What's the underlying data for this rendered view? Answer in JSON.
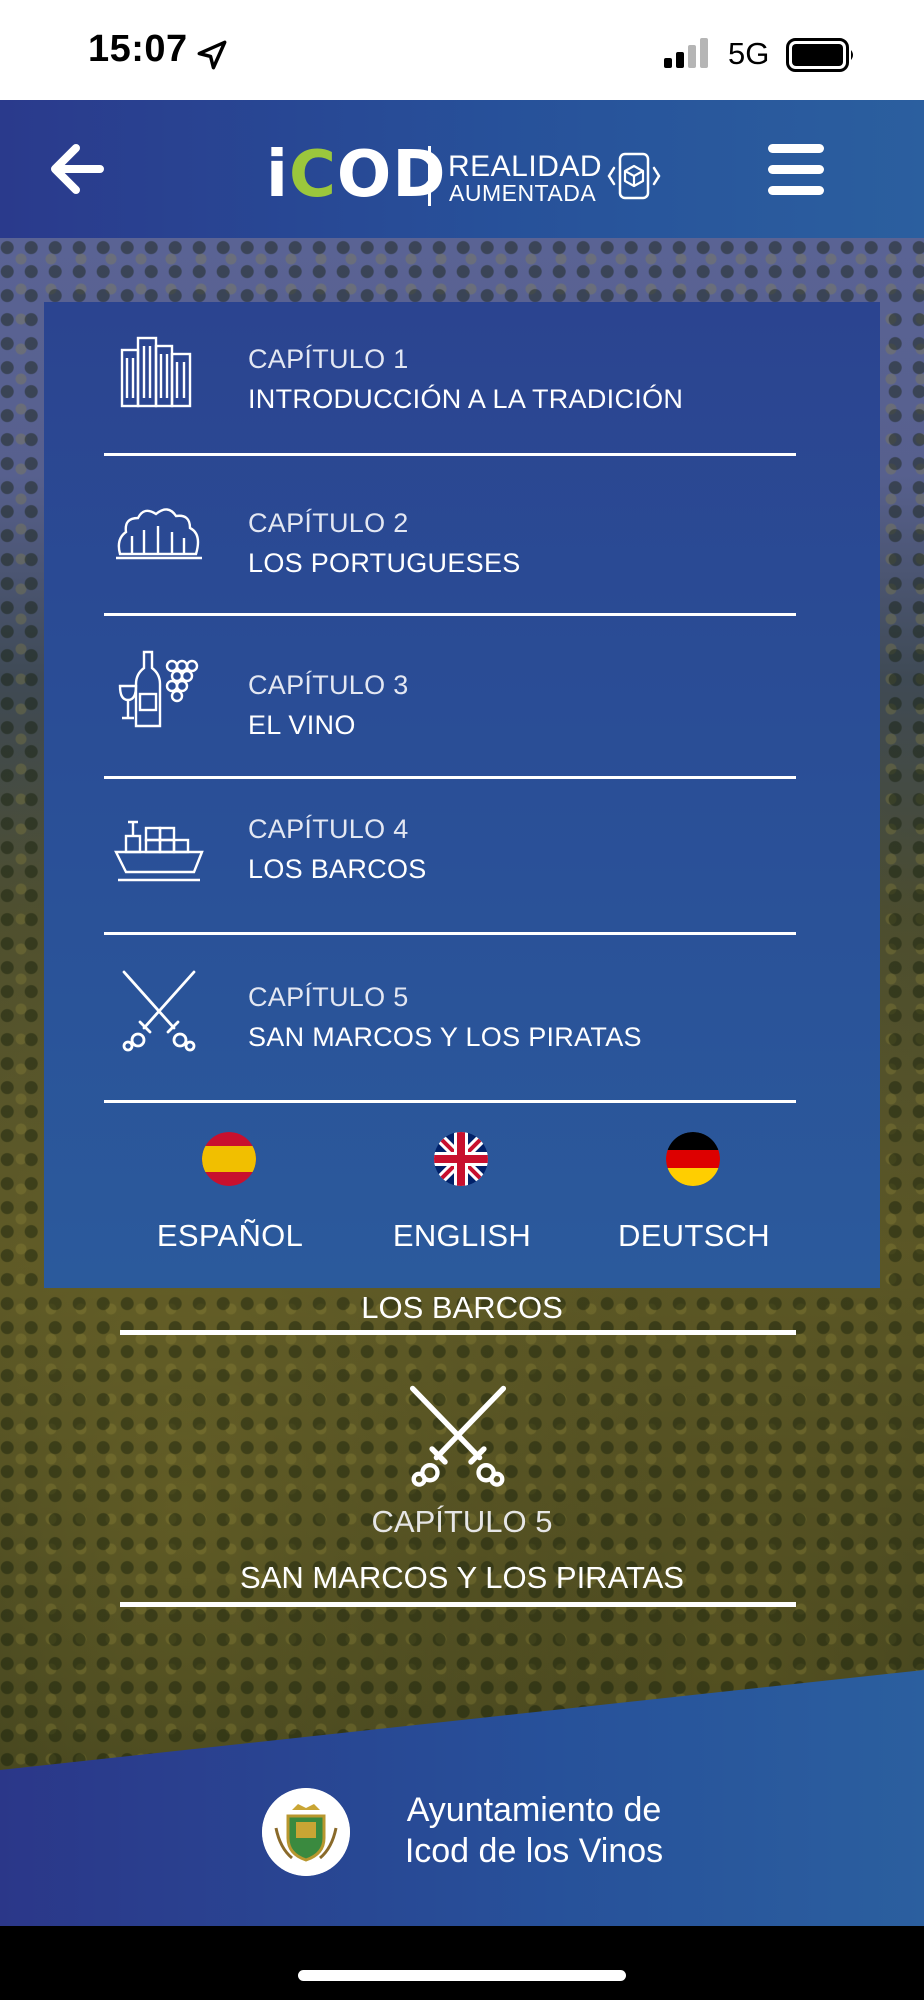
{
  "status_bar": {
    "time": "15:07",
    "network": "5G"
  },
  "header": {
    "brand_main_prefix": "i",
    "brand_main_accent": "C",
    "brand_main_suffix": "OD",
    "brand_line1": "REALIDAD",
    "brand_line2": "AUMENTADA",
    "accent_color": "#9bc73c",
    "icons": [
      "back-arrow-icon",
      "augmented-reality-icon",
      "hamburger-menu-icon"
    ]
  },
  "menu": {
    "chapters": [
      {
        "label": "CAPÍTULO 1",
        "title": "INTRODUCCIÓN A LA TRADICIÓN",
        "icon": "buildings-icon"
      },
      {
        "label": "CAPÍTULO 2",
        "title": "LOS PORTUGUESES",
        "icon": "trees-icon"
      },
      {
        "label": "CAPÍTULO 3",
        "title": "EL VINO",
        "icon": "wine-icon"
      },
      {
        "label": "CAPÍTULO 4",
        "title": "LOS BARCOS",
        "icon": "ship-icon"
      },
      {
        "label": "CAPÍTULO 5",
        "title": "SAN MARCOS Y LOS PIRATAS",
        "icon": "crossed-swords-icon"
      }
    ],
    "languages": [
      {
        "label": "ESPAÑOL",
        "icon": "spain-flag-icon"
      },
      {
        "label": "ENGLISH",
        "icon": "uk-flag-icon"
      },
      {
        "label": "DEUTSCH",
        "icon": "germany-flag-icon"
      }
    ]
  },
  "background": {
    "chapter4_title": "LOS BARCOS",
    "chapter5_label": "CAPÍTULO 5",
    "chapter5_title": "SAN MARCOS Y LOS PIRATAS"
  },
  "footer": {
    "line1": "Ayuntamiento de",
    "line2": "Icod de los Vinos"
  },
  "colors": {
    "header_blue": "#27519a",
    "panel_blue": "#2a4f97",
    "spain_red": "#c8102e",
    "spain_yellow": "#f1bf00"
  }
}
